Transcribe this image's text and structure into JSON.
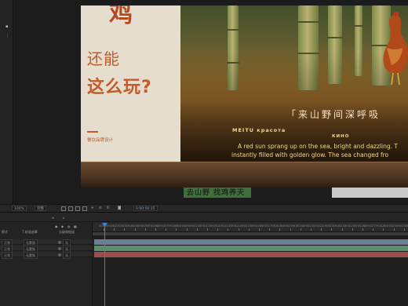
{
  "project_panel": {
    "icons": [
      "folder-icon",
      "grid-icon"
    ]
  },
  "composition": {
    "big_char": "鸡",
    "headline_1": "还能",
    "headline_2": "这么玩?",
    "brand_sub": "餐饮品牌设计",
    "quote": "「来山野间深呼吸",
    "meitu_line": "MEITU красота",
    "kino": "КИНО",
    "desc_1": "A red sun sprang up on the sea, bright and dazzling. T",
    "desc_2": "instantly filled with golden glow. The sea changed fro",
    "sign_text": "去山野  找鸡养天"
  },
  "viewer_footer": {
    "zoom": "100%",
    "resolution": "完整",
    "timecode": "0:00:00:15",
    "icons": [
      "camera-icon",
      "mask-icon",
      "grid-icon",
      "channel-icon",
      "region-icon",
      "transparency-icon"
    ]
  },
  "timeline": {
    "tab_label": "≡",
    "col_headers": {
      "mode": "模式",
      "trkmat": "T  轨道遮罩",
      "parent": "父级和链接"
    },
    "layers": [
      {
        "mode": "正常",
        "trkmat": "无蒙版",
        "parent": "无"
      },
      {
        "mode": "正常",
        "trkmat": "无蒙版",
        "parent": "无"
      },
      {
        "mode": "正常",
        "trkmat": "无蒙版",
        "parent": "无"
      }
    ],
    "ruler_labels": [
      "00010f",
      "00020f",
      "00030f",
      "00040f",
      "00050f",
      "00060f",
      "00070f",
      "00080f",
      "00090f",
      "00100f",
      "00110f",
      "00120f",
      "00130f",
      "00140f",
      "00150f",
      "00160f",
      "00170f",
      "00180f",
      "00190f",
      "00200f",
      "00210f",
      "00220f",
      "00230f",
      "00240f",
      "00250f",
      "00260f",
      "00270f",
      "00280f",
      "00290f",
      "00300f"
    ],
    "layer_colors": [
      "#6b7f99",
      "#5d8f6e",
      "#9b4d4d"
    ]
  }
}
